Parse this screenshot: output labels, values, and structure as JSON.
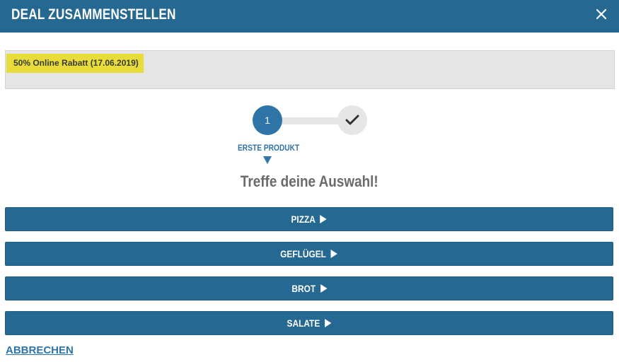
{
  "header": {
    "title": "DEAL ZUSAMMENSTELLEN",
    "close_icon": "close-icon"
  },
  "promo": {
    "badge_text": "50% Online Rabatt (17.06.2019)"
  },
  "stepper": {
    "step1_number": "1",
    "step1_label": "ERSTE PRODUKT",
    "step2_icon": "checkmark-icon",
    "current_step": 1
  },
  "main": {
    "prompt": "Treffe deine Auswahl!",
    "choices": [
      {
        "label": "PIZZA"
      },
      {
        "label": "GEFLÜGEL"
      },
      {
        "label": "BROT"
      },
      {
        "label": "SALATE"
      }
    ]
  },
  "footer": {
    "cancel_label": "ABBRECHEN"
  },
  "colors": {
    "brand_blue": "#256891",
    "step_blue": "#2f74a6",
    "promo_yellow": "#e8dc3a",
    "panel_gray": "#e5e5e5"
  }
}
